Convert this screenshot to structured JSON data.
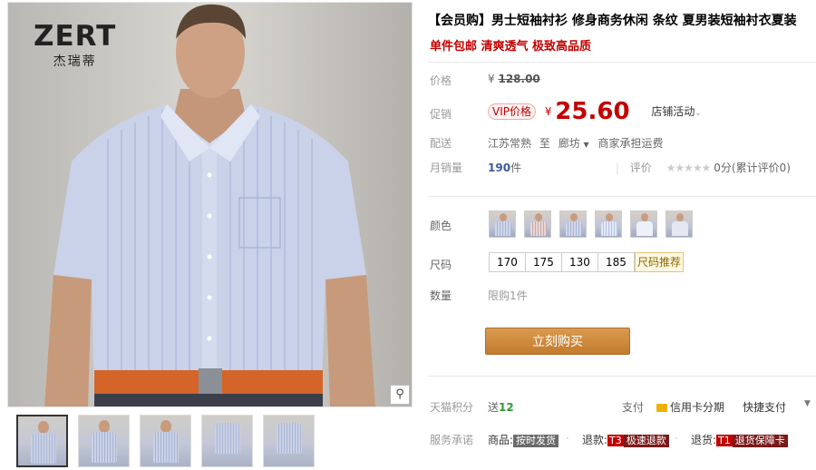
{
  "brand": {
    "name_en": "ZERT",
    "name_cn": "杰瑞蒂"
  },
  "product": {
    "title": "【会员购】男士短袖衬衫 修身商务休闲 条纹 夏男装短袖衬衣夏装",
    "subtitle": "单件包邮 清爽透气 极致高品质"
  },
  "price": {
    "label": "价格",
    "currency": "¥",
    "original": "128.00",
    "promo_label": "促销",
    "vip_badge": "VIP价格",
    "promo_price": "25.60",
    "shop_promo": "店铺活动"
  },
  "shipping": {
    "label": "配送",
    "from": "江苏常熟",
    "to_word": "至",
    "to": "廊坊",
    "fee_note": "商家承担运费"
  },
  "sales": {
    "label": "月销量",
    "count": "190",
    "unit": "件",
    "rating_label": "评价",
    "stars": "★★★★★",
    "rating_text": "0分(累计评价0)"
  },
  "colors": {
    "label": "颜色",
    "count": 6
  },
  "sizes": {
    "label": "尺码",
    "options": [
      "170",
      "175",
      "130",
      "185"
    ],
    "guide": "尺码推荐"
  },
  "quantity": {
    "label": "数量",
    "limit": "限购1件"
  },
  "buy_button": "立刻购买",
  "points": {
    "label": "天猫积分",
    "prefix": "送",
    "value": "12"
  },
  "payment": {
    "label": "支付",
    "credit": "信用卡分期",
    "quick": "快捷支付"
  },
  "service": {
    "label": "服务承诺",
    "item1_label": "商品:",
    "item1_tag": "按时发货",
    "item2_label": "退款:",
    "item2_t": "T3",
    "item2_tag": "极速退款",
    "item3_label": "退货:",
    "item3_t": "T1",
    "item3_tag": "退货保障卡"
  },
  "gallery": {
    "thumb_count": 5,
    "active_thumb": 0
  },
  "icons": {
    "zoom": "magnifier-icon",
    "dropdown": "chevron-down-icon",
    "card": "credit-card-icon"
  },
  "colors_theme": {
    "accent": "#c40000",
    "buy": "#c8833a",
    "link_blue": "#3c5a9a"
  }
}
